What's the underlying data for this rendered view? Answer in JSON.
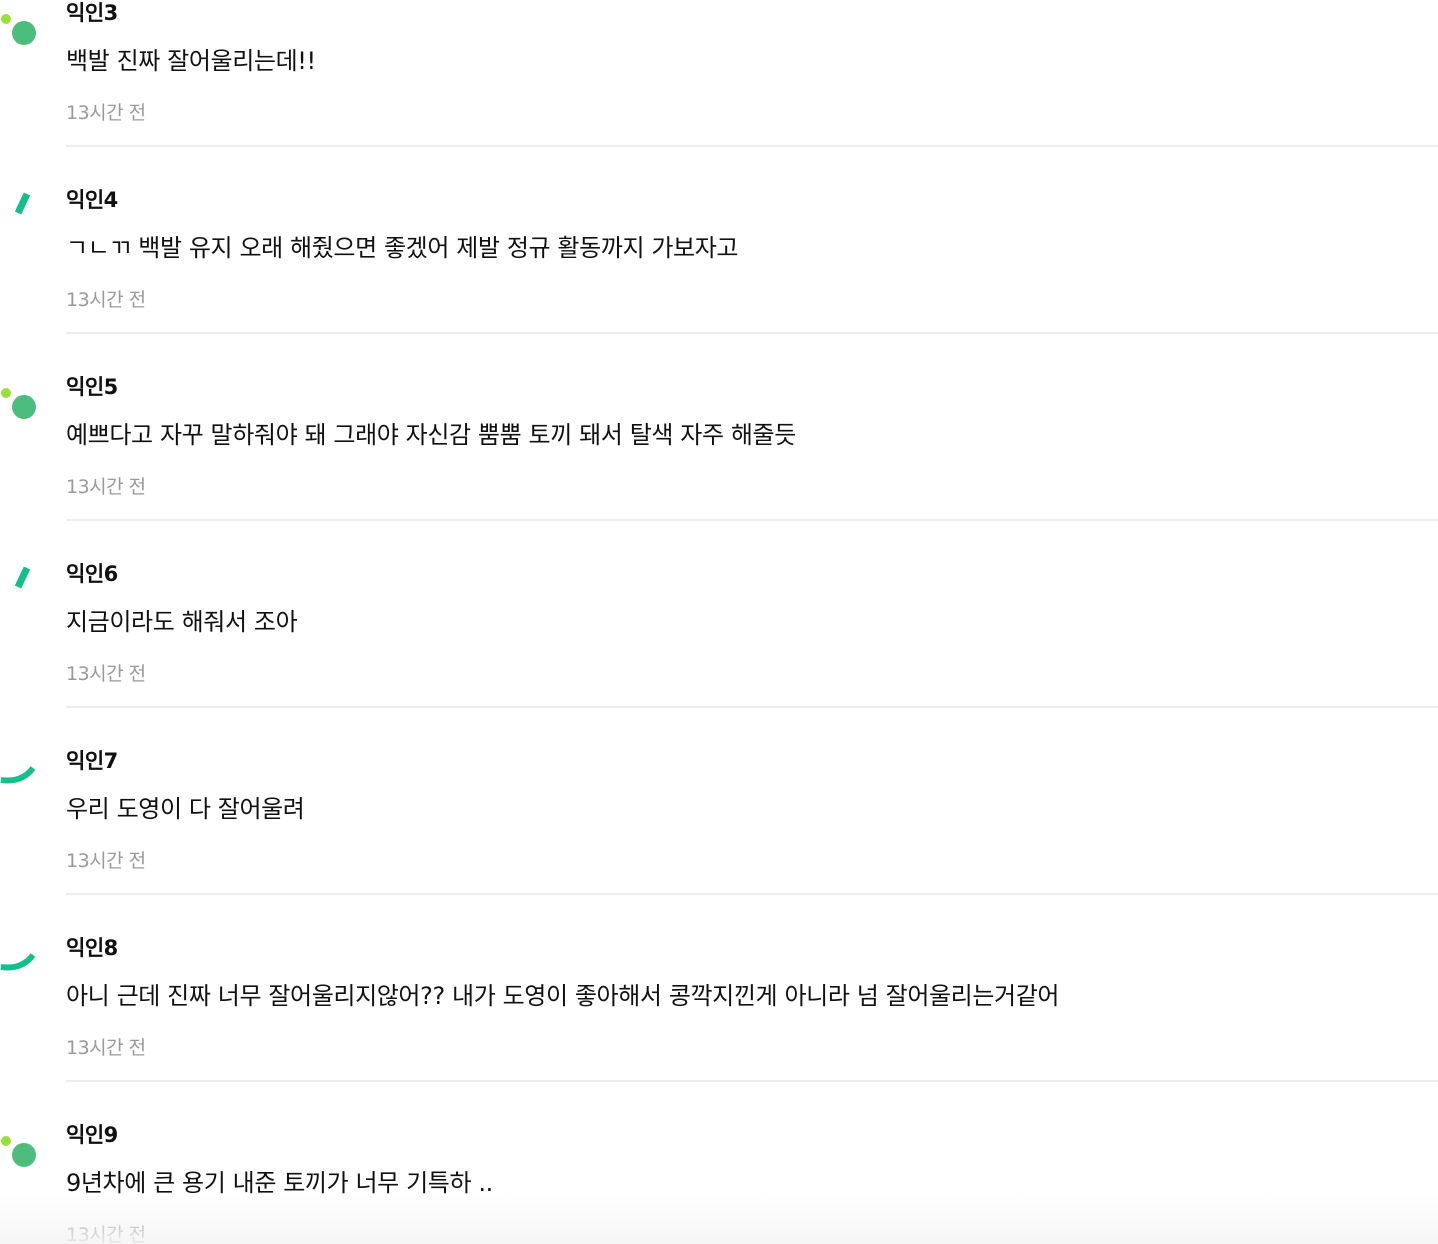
{
  "comments": [
    {
      "author": "익인3",
      "text": "백발 진짜 잘어울리는데!!",
      "time": "13시간 전",
      "avatar_icon": "dots-avatar-icon"
    },
    {
      "author": "익인4",
      "text": "ㄱㄴㄲ 백발 유지 오래 해줬으면 좋겠어 제발 정규 활동까지 가보자고",
      "time": "13시간 전",
      "avatar_icon": "slash-avatar-icon"
    },
    {
      "author": "익인5",
      "text": "예쁘다고 자꾸 말하줘야 돼 그래야 자신감 뿜뿜 토끼 돼서 탈색 자주 해줄듯",
      "time": "13시간 전",
      "avatar_icon": "dots-avatar-icon"
    },
    {
      "author": "익인6",
      "text": "지금이라도 해줘서 조아",
      "time": "13시간 전",
      "avatar_icon": "slash-avatar-icon"
    },
    {
      "author": "익인7",
      "text": "우리 도영이 다 잘어울려",
      "time": "13시간 전",
      "avatar_icon": "smile-avatar-icon"
    },
    {
      "author": "익인8",
      "text": "아니 근데 진짜 너무 잘어울리지않어?? 내가 도영이 좋아해서 콩깍지낀게 아니라 넘 잘어울리는거같어",
      "time": "13시간 전",
      "avatar_icon": "smile-avatar-icon"
    },
    {
      "author": "익인9",
      "text": "9년차에 큰 용기 내준 토끼가 너무 기특하 ..",
      "time": "13시간 전",
      "avatar_icon": "dots-avatar-icon"
    }
  ],
  "colors": {
    "avatar_green": "#4dbd7e",
    "avatar_lime": "#9adf3c",
    "avatar_teal": "#13c08c",
    "divider": "#ececec",
    "time_text": "#9a9a9a",
    "body_text": "#111111"
  }
}
